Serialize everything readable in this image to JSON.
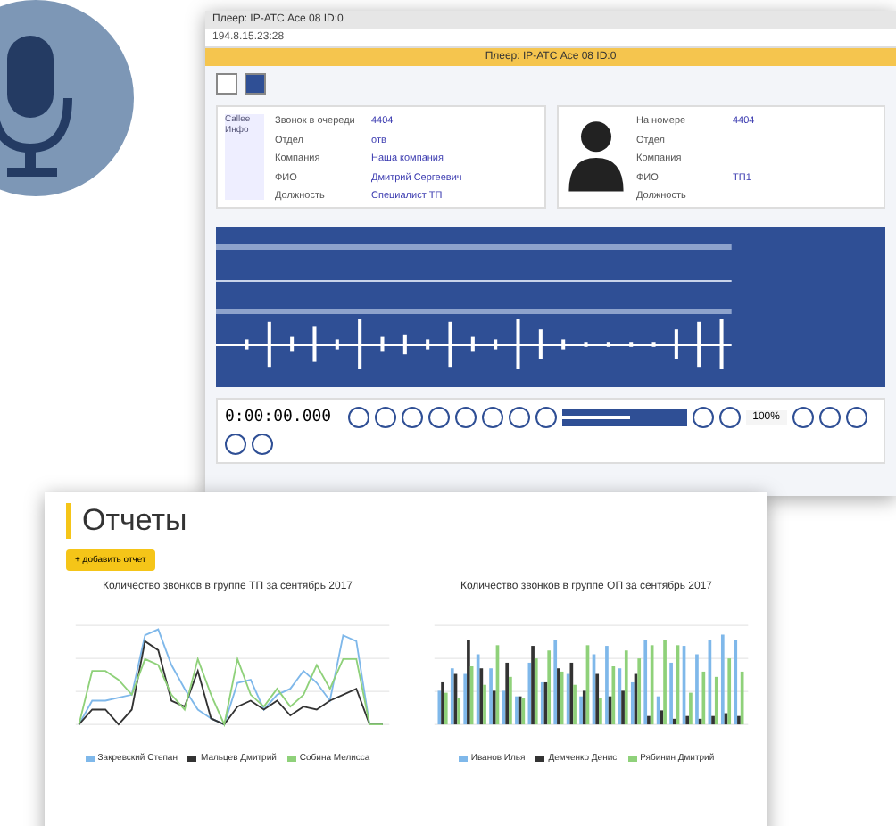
{
  "player": {
    "title": "Плеер: IP-АТС Асе 08 ID:0",
    "address": "194.8.15.23:28",
    "header": "Плеер: IP-АТС Асе 08 ID:0",
    "caller": {
      "tag": "Callee Инфо",
      "fields": [
        {
          "label": "Звонок в очереди",
          "value": "4404"
        },
        {
          "label": "Отдел",
          "value": "отв"
        },
        {
          "label": "Компания",
          "value": "Наша компания"
        },
        {
          "label": "ФИО",
          "value": "Дмитрий Сергеевич"
        },
        {
          "label": "Должность",
          "value": "Специалист ТП"
        }
      ]
    },
    "callee": {
      "fields": [
        {
          "label": "На номере",
          "value": "4404"
        },
        {
          "label": "Отдел"
        },
        {
          "label": "Компания"
        },
        {
          "label": "ФИО",
          "value": "ТП1"
        },
        {
          "label": "Должность"
        }
      ]
    },
    "time": "0:00:00.000",
    "zoom": "100%",
    "volume": {
      "level": 0.55
    }
  },
  "reports": {
    "title": "Отчеты",
    "add_button": "+ добавить отчет",
    "charts": [
      {
        "kind": "line",
        "title": "Количество звонков в группе ТП за сентябрь 2017",
        "legend": [
          {
            "name": "Закревский Степан",
            "color": "#7fb8ea"
          },
          {
            "name": "Мальцев Дмитрий",
            "color": "#333333"
          },
          {
            "name": "Собина Мелисса",
            "color": "#8fd17a"
          }
        ]
      },
      {
        "kind": "bar",
        "title": "Количество звонков в группе ОП за сентябрь 2017",
        "legend": [
          {
            "name": "Иванов Илья",
            "color": "#7fb8ea"
          },
          {
            "name": "Демченко Денис",
            "color": "#333333"
          },
          {
            "name": "Рябинин Дмитрий",
            "color": "#8fd17a"
          }
        ]
      }
    ]
  }
}
